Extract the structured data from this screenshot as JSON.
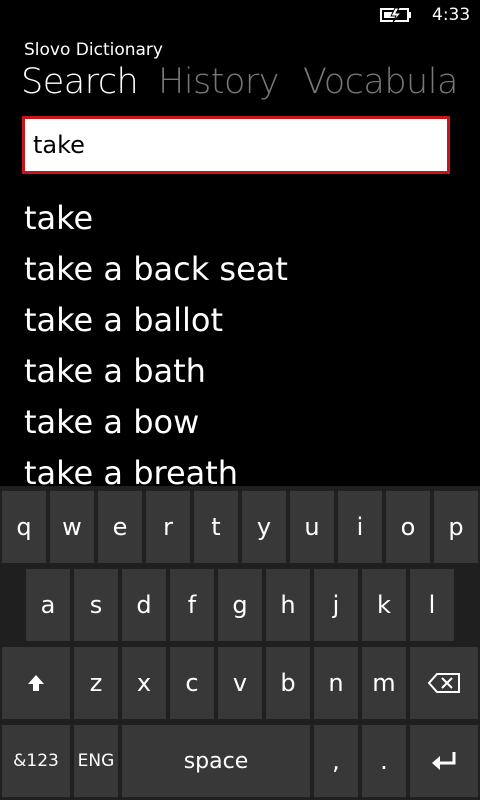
{
  "status_bar": {
    "time": "4:33",
    "battery_icon": "battery-charging-icon"
  },
  "app": {
    "title": "Slovo Dictionary"
  },
  "pivot": {
    "items": [
      "Search",
      "History",
      "Vocabula"
    ],
    "active_index": 0
  },
  "search": {
    "value": "take",
    "placeholder": ""
  },
  "results": [
    "take",
    "take a back seat",
    "take a ballot",
    "take a bath",
    "take a bow",
    "take a breath"
  ],
  "keyboard": {
    "row1": [
      "q",
      "w",
      "e",
      "r",
      "t",
      "y",
      "u",
      "i",
      "o",
      "p"
    ],
    "row2": [
      "a",
      "s",
      "d",
      "f",
      "g",
      "h",
      "j",
      "k",
      "l"
    ],
    "row3_letters": [
      "z",
      "x",
      "c",
      "v",
      "b",
      "n",
      "m"
    ],
    "shift_icon": "shift-arrow-icon",
    "backspace_icon": "backspace-icon",
    "numbers_label": "&123",
    "language_label": "ENG",
    "space_label": "space",
    "comma_label": ",",
    "period_label": ".",
    "enter_icon": "enter-arrow-icon"
  },
  "colors": {
    "accent": "#c8141b",
    "background": "#000000",
    "inactive_pivot": "#777777",
    "key": "#383838",
    "keyboard_bg": "#1f1f1f"
  }
}
